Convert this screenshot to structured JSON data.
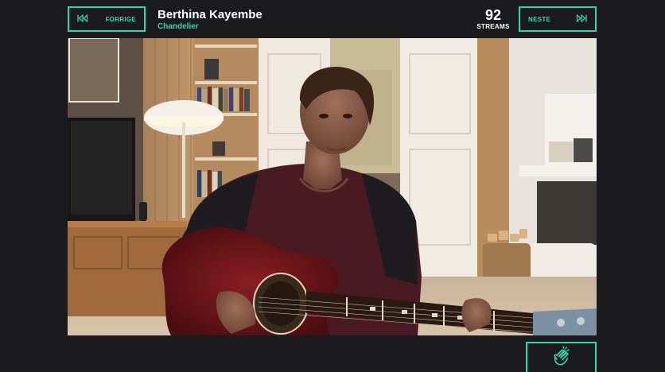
{
  "nav": {
    "prev_label": "FORRIGE",
    "next_label": "NESTE"
  },
  "artist": {
    "name": "Berthina Kayembe",
    "song": "Chandelier"
  },
  "streams": {
    "count": "92",
    "label": "STREAMS"
  },
  "icons": {
    "prev": "skip-back-icon",
    "next": "skip-forward-icon",
    "clap": "clapping-hands-icon"
  },
  "colors": {
    "accent": "#2fd9a8",
    "background": "#1b1a1c",
    "text": "#ffffff"
  }
}
